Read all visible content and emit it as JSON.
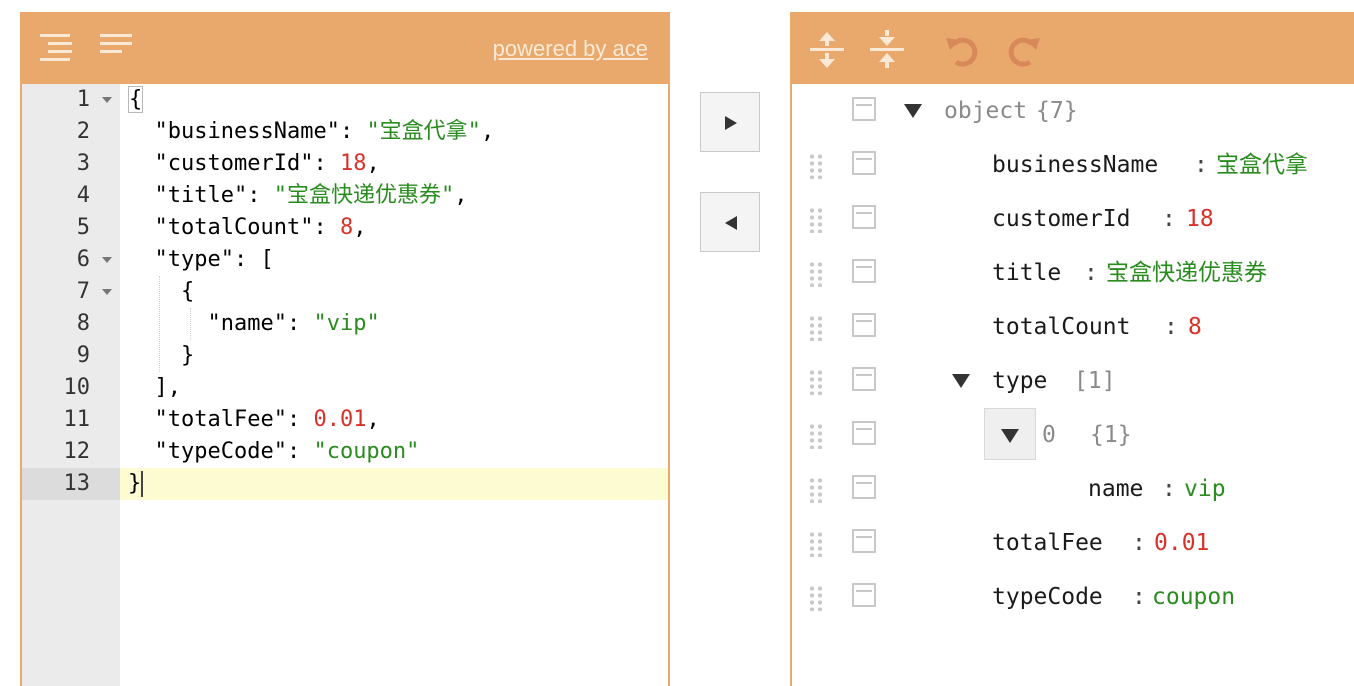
{
  "left": {
    "powered_link": "powered by ace",
    "toolbar_icons": [
      "format-icon",
      "compact-icon"
    ],
    "lines": [
      {
        "num": "1",
        "fold": true
      },
      {
        "num": "2"
      },
      {
        "num": "3"
      },
      {
        "num": "4"
      },
      {
        "num": "5"
      },
      {
        "num": "6",
        "fold": true
      },
      {
        "num": "7",
        "fold": true
      },
      {
        "num": "8"
      },
      {
        "num": "9"
      },
      {
        "num": "10"
      },
      {
        "num": "11"
      },
      {
        "num": "12"
      },
      {
        "num": "13"
      }
    ],
    "code": {
      "l1": "{",
      "l2_key": "\"businessName\"",
      "l2_val": "\"宝盒代拿\"",
      "l3_key": "\"customerId\"",
      "l3_val": "18",
      "l4_key": "\"title\"",
      "l4_val": "\"宝盒快递优惠券\"",
      "l5_key": "\"totalCount\"",
      "l5_val": "8",
      "l6_key": "\"type\"",
      "l6_val": "[",
      "l7": "{",
      "l8_key": "\"name\"",
      "l8_val": "\"vip\"",
      "l9": "}",
      "l10": "],",
      "l11_key": "\"totalFee\"",
      "l11_val": "0.01",
      "l12_key": "\"typeCode\"",
      "l12_val": "\"coupon\"",
      "l13": "}"
    }
  },
  "middle": {
    "copy_right_icon": "arrow-right-icon",
    "copy_left_icon": "arrow-left-icon"
  },
  "right": {
    "toolbar_icons": [
      "expand-all-icon",
      "collapse-all-icon",
      "undo-icon",
      "redo-icon"
    ],
    "tree": {
      "root_label": "object",
      "root_count": "{7}",
      "businessName_key": "businessName",
      "businessName_val": "宝盒代拿",
      "customerId_key": "customerId",
      "customerId_val": "18",
      "title_key": "title",
      "title_val": "宝盒快递优惠券",
      "totalCount_key": "totalCount",
      "totalCount_val": "8",
      "type_key": "type",
      "type_count": "[1]",
      "item0_key": "0",
      "item0_count": "{1}",
      "name_key": "name",
      "name_val": "vip",
      "totalFee_key": "totalFee",
      "totalFee_val": "0.01",
      "typeCode_key": "typeCode",
      "typeCode_val": "coupon"
    }
  },
  "colors": {
    "accent": "#e9a86c",
    "string": "#2a8c1f",
    "number": "#d6322a",
    "active_line": "#fdfbd2"
  }
}
